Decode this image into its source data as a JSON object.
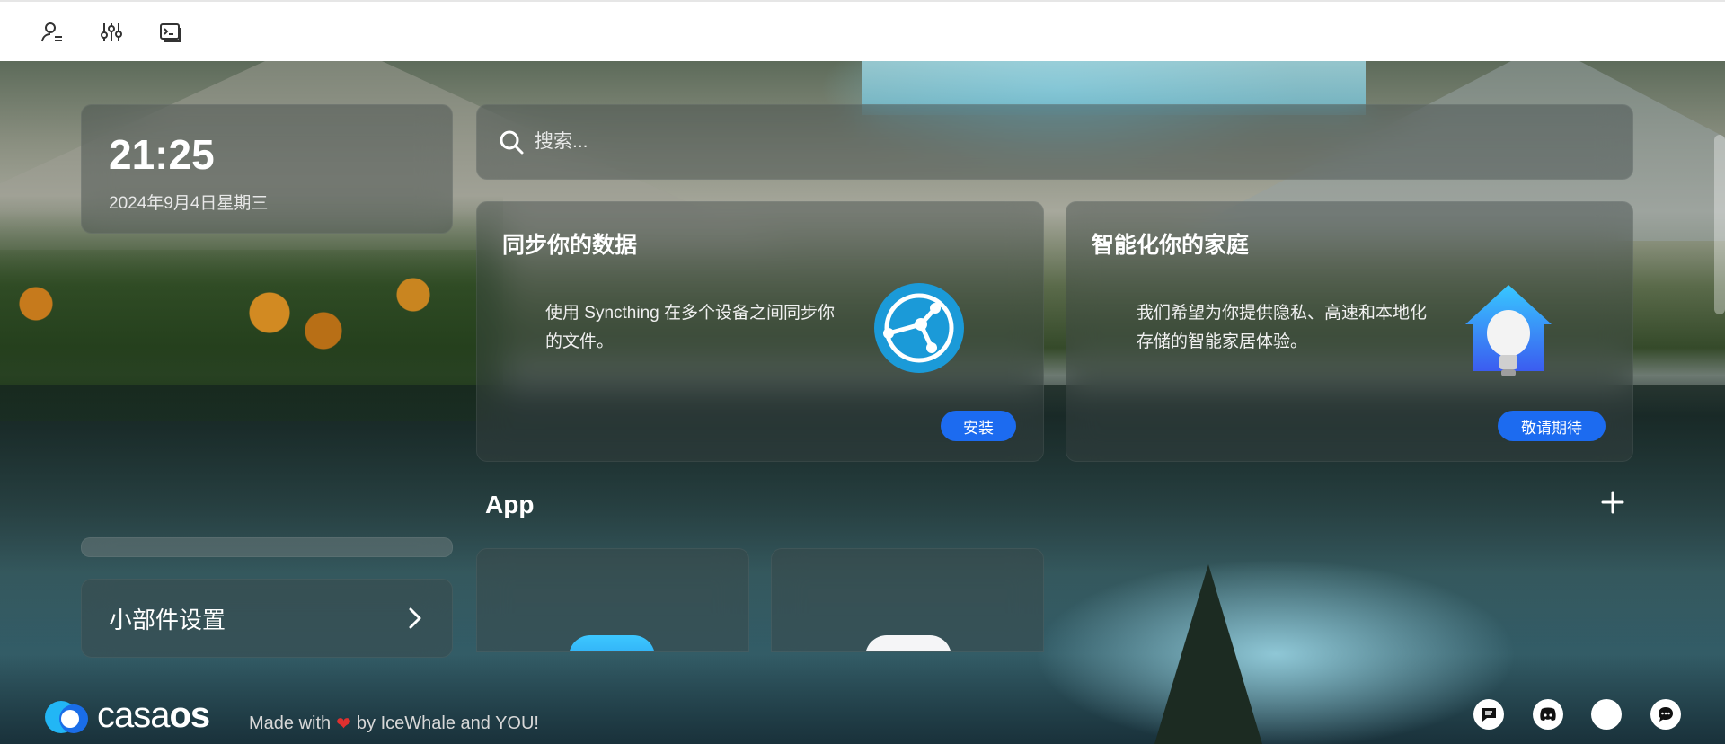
{
  "toolbar": {
    "icons": [
      "user-settings-icon",
      "sliders-icon",
      "terminal-window-icon"
    ]
  },
  "clock": {
    "time": "21:25",
    "date": "2024年9月4日星期三"
  },
  "search": {
    "placeholder": "搜索..."
  },
  "cards": {
    "sync": {
      "title": "同步你的数据",
      "text": "使用 Syncthing 在多个设备之间同步你的文件。",
      "button": "安装"
    },
    "home": {
      "title": "智能化你的家庭",
      "text": "我们希望为你提供隐私、高速和本地化存储的智能家居体验。",
      "button": "敬请期待"
    }
  },
  "apps": {
    "title": "App",
    "add_icon": "plus-icon"
  },
  "widget_settings": {
    "label": "小部件设置"
  },
  "footer": {
    "brand": {
      "part1": "casa",
      "part2": "os"
    },
    "made_with": "Made with",
    "by": "by IceWhale and YOU!",
    "icons": [
      "feedback-icon",
      "discord-icon",
      "github-icon",
      "chat-icon"
    ]
  },
  "colors": {
    "accent": "#1c6bf0",
    "brand_blue": "#3aa7f5",
    "heart": "#e0302f"
  }
}
